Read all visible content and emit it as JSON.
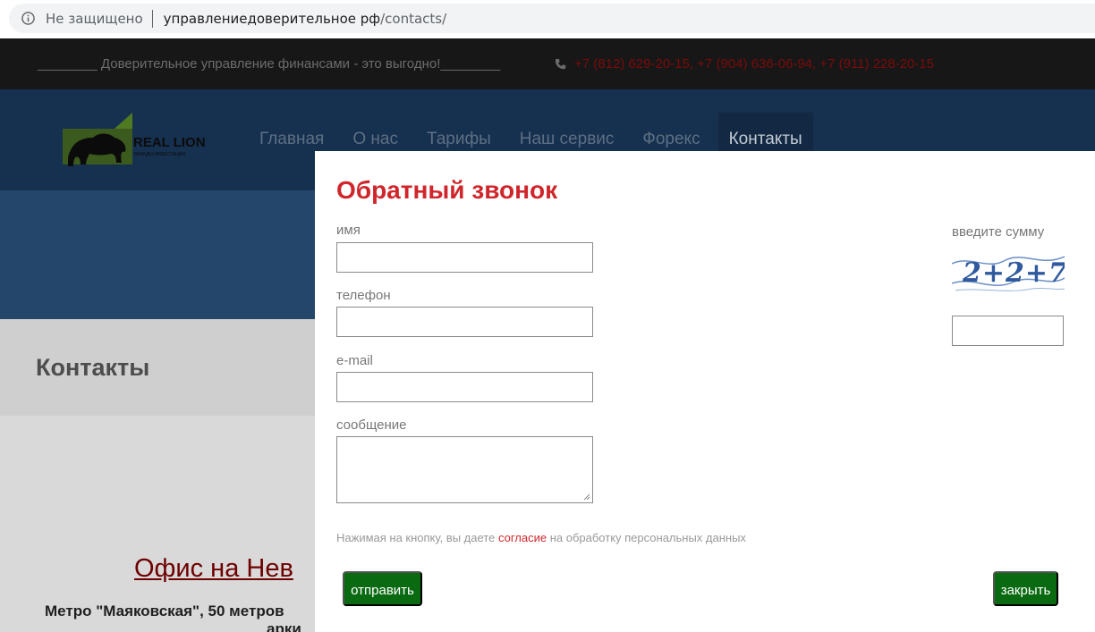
{
  "browser": {
    "security": "Не защищено",
    "url_host": "управлениедоверительное рф",
    "url_path": "/contacts/"
  },
  "topbar": {
    "slogan": "________ Доверительное управление финансами - это выгодно!________",
    "phones": "+7 (812) 629-20-15, +7 (904) 636-06-94, +7 (911) 228-20-15"
  },
  "nav": {
    "items": [
      "Главная",
      "О нас",
      "Тарифы",
      "Наш сервис",
      "Форекс",
      "Контакты"
    ],
    "active": "Контакты"
  },
  "page": {
    "title": "Контакты",
    "office": "Офис на Нев",
    "metro": "Метро \"Маяковская\", 50 метров",
    "metro2": "арки"
  },
  "modal": {
    "title": "Обратный звонок",
    "name_label": "имя",
    "phone_label": "телефон",
    "email_label": "e-mail",
    "message_label": "сообщение",
    "captcha_label": "введите сумму",
    "captcha_text": "2+2+7",
    "consent_before": "Нажимая на кнопку, вы даете ",
    "consent_link": "согласие",
    "consent_after": " на обработку персональных данных",
    "send_button": "отправить",
    "close_button": "закрыть"
  },
  "colors": {
    "accent_red": "#d0262b",
    "button_green": "#0a6a12",
    "nav_bg": "#16304f"
  }
}
